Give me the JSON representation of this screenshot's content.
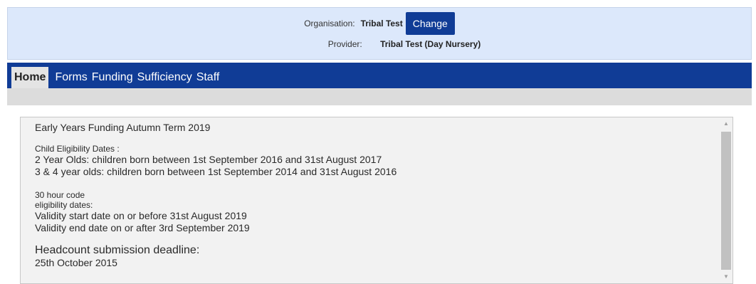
{
  "header": {
    "organisation_label": "Organisation:",
    "organisation_value": "Tribal Test",
    "change_label": "Change",
    "provider_label": "Provider:",
    "provider_value": "Tribal Test (Day Nursery)"
  },
  "nav": {
    "items": [
      "Home",
      "Forms",
      "Funding",
      "Sufficiency",
      "Staff"
    ],
    "active": "Home"
  },
  "content": {
    "title": "Early Years Funding Autumn Term 2019",
    "eligibility_heading": "Child Eligibility Dates :",
    "eligibility_line_1": "2 Year Olds: children born between 1st September 2016 and 31st August 2017",
    "eligibility_line_2": "3 & 4 year olds: children born between 1st September 2014 and 31st August 2016",
    "code_heading_1": "30 hour code",
    "code_heading_2": "eligibility dates:",
    "validity_start": "Validity start date on or before 31st August 2019",
    "validity_end": "Validity end date on or after 3rd September 2019",
    "headcount_heading": "Headcount submission deadline:",
    "headcount_date": "25th October 2015"
  },
  "scrollbar": {
    "up_icon": "triangle-up-icon",
    "down_icon": "triangle-down-icon"
  },
  "colors": {
    "header_bg": "#dce8fb",
    "nav_bg": "#103c96",
    "active_tab_bg": "#e4e4e4",
    "content_bg": "#f2f2f2"
  }
}
